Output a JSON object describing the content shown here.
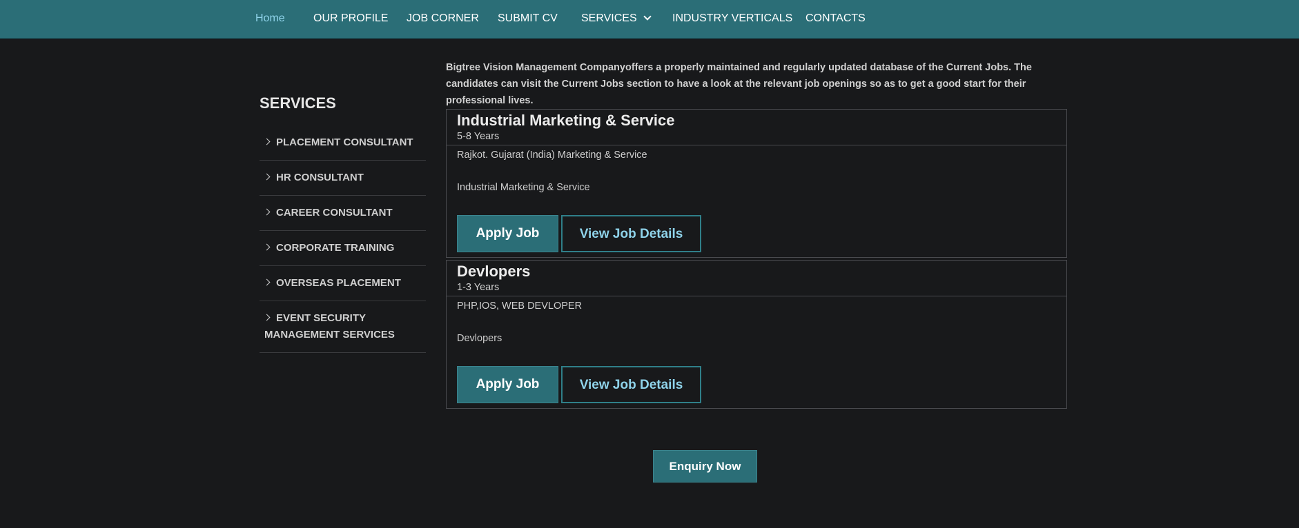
{
  "nav": {
    "items": [
      {
        "label": "Home",
        "active": true
      },
      {
        "label": "OUR PROFILE"
      },
      {
        "label": "JOB CORNER"
      },
      {
        "label": "SUBMIT CV"
      },
      {
        "label": "SERVICES",
        "icon": "chevron-down-icon"
      },
      {
        "label": "INDUSTRY VERTICALS"
      },
      {
        "label": "CONTACTS"
      }
    ]
  },
  "sidebar": {
    "title": "SERVICES",
    "items": [
      {
        "label": "PLACEMENT CONSULTANT",
        "icon": "chevron-right-icon"
      },
      {
        "label": "HR CONSULTANT",
        "icon": "chevron-right-icon"
      },
      {
        "label": "CAREER CONSULTANT",
        "icon": "chevron-right-icon"
      },
      {
        "label": "CORPORATE TRAINING",
        "icon": "chevron-right-icon"
      },
      {
        "label": "OVERSEAS PLACEMENT",
        "icon": "chevron-right-icon"
      },
      {
        "label": "EVENT SECURITY MANAGEMENT SERVICES",
        "icon": "chevron-right-icon"
      }
    ]
  },
  "main": {
    "intro": "Bigtree Vision Management Companyoffers a properly maintained and regularly updated database of the Current Jobs. The candidates can visit the Current Jobs section to have a look at the relevant job openings so as to get a good start for their professional lives.",
    "jobs": [
      {
        "title": "Industrial Marketing & Service",
        "experience": "5-8 Years",
        "location_line": "Rajkot. Gujarat (India) Marketing & Service",
        "description": "Industrial Marketing & Service",
        "apply_label": "Apply Job",
        "view_label": "View Job Details"
      },
      {
        "title": "Devlopers",
        "experience": "1-3 Years",
        "location_line": "PHP,IOS, WEB DEVLOPER",
        "description": "Devlopers",
        "apply_label": "Apply Job",
        "view_label": "View Job Details"
      }
    ],
    "enquiry_label": "Enquiry Now"
  },
  "colors": {
    "navbar": "#2b6e77",
    "background": "#18191b",
    "accent_text": "#8fd3ea"
  }
}
